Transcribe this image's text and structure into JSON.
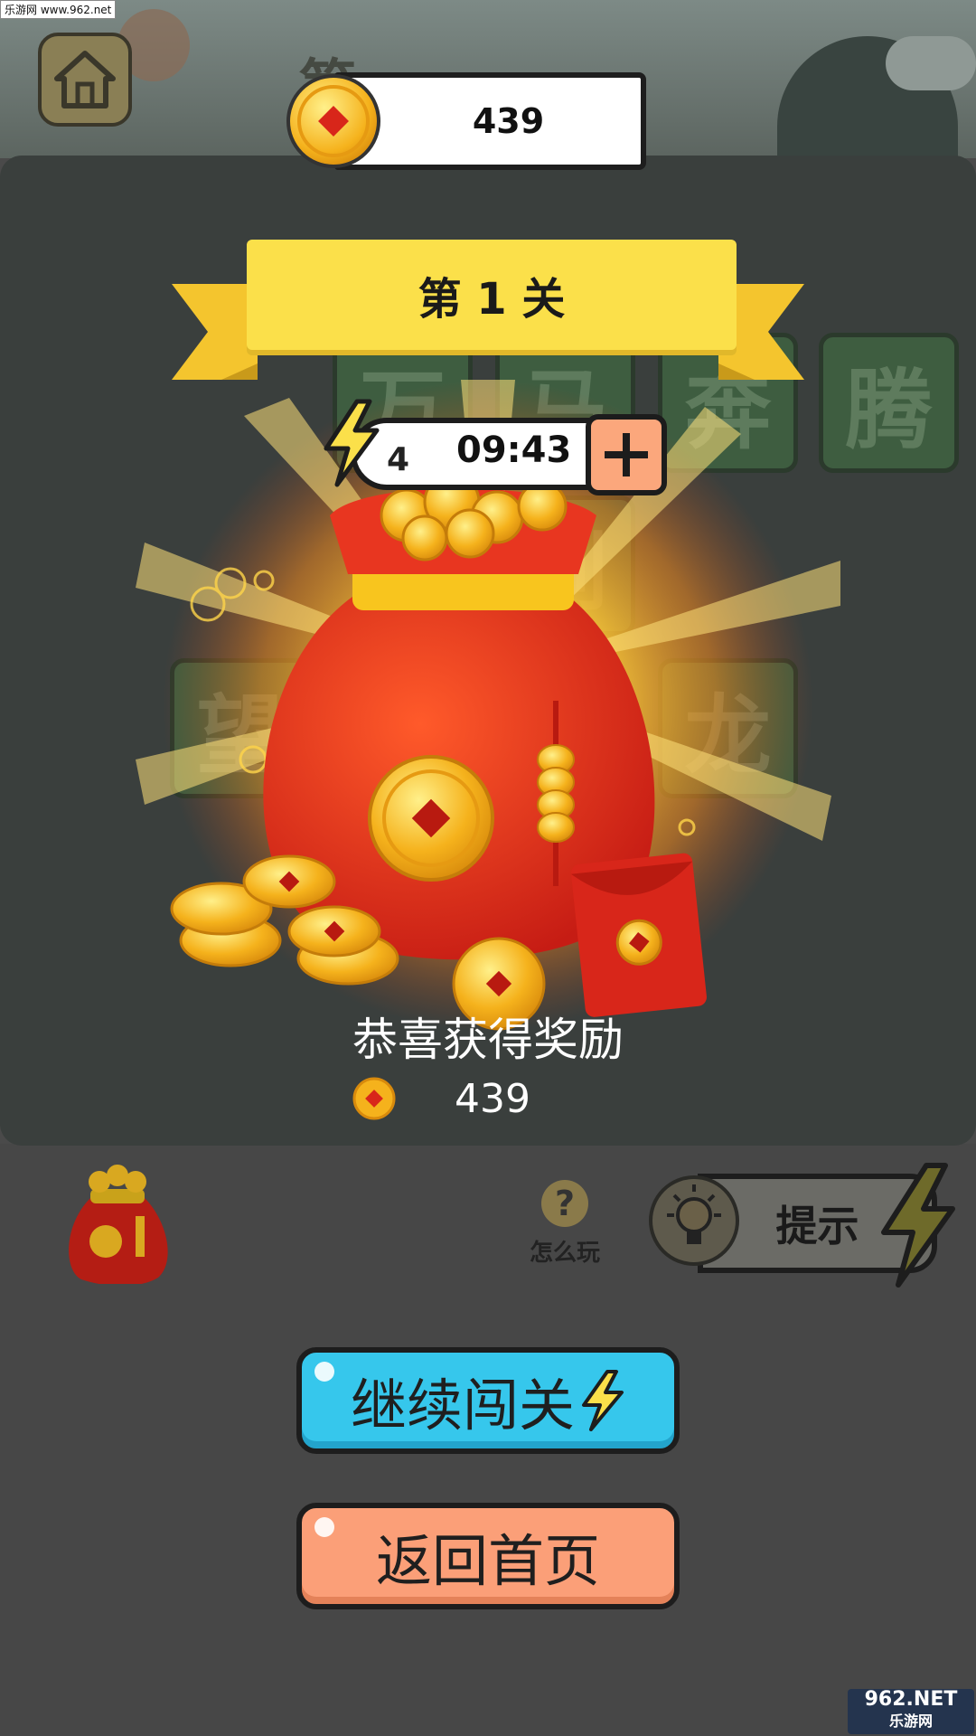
{
  "watermark": {
    "site": "乐游网 www.962.net",
    "logo_main": "962.NET",
    "logo_sub": "乐游网"
  },
  "header": {
    "coins": "439",
    "bg_title": "第 1 关"
  },
  "banner": {
    "title": "第 1 关"
  },
  "tiles": [
    "万",
    "马",
    "奔",
    "腾",
    "到",
    "望",
    "龙"
  ],
  "energy": {
    "count": "4",
    "timer": "09:43"
  },
  "reward": {
    "title": "恭喜获得奖励",
    "amount": "439"
  },
  "bottom": {
    "howto_label": "怎么玩",
    "howto_icon": "?",
    "hint_label": "提示"
  },
  "buttons": {
    "continue": "继续闯关",
    "home": "返回首页"
  },
  "colors": {
    "coin": "#f5b21c",
    "banner": "#fbe04a",
    "continue": "#36c7ec",
    "home": "#fb9f78",
    "bag": "#d8261a"
  }
}
